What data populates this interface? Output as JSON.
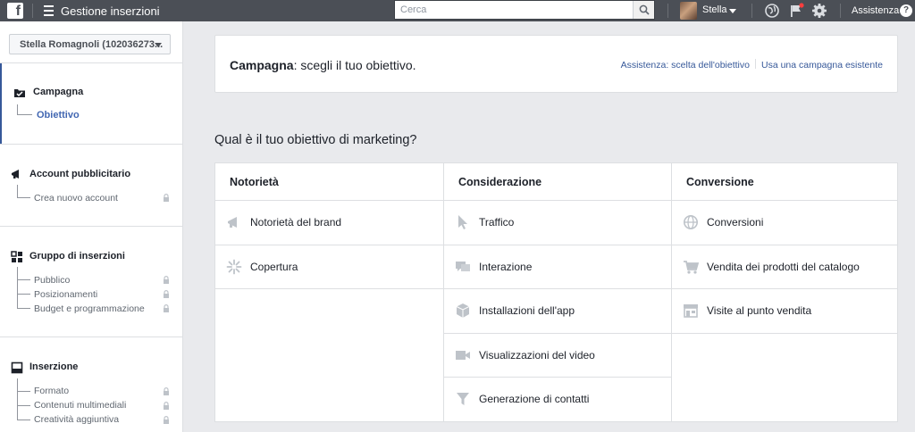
{
  "topbar": {
    "logo": "f",
    "title": "Gestione inserzioni",
    "search_placeholder": "Cerca",
    "user_name": "Stella",
    "help_label": "Assistenza",
    "icons": [
      "facebook-logo",
      "menu-icon",
      "search-icon",
      "globe-icon",
      "flag-icon",
      "gear-icon",
      "help-icon"
    ]
  },
  "sidebar": {
    "account_selector": "Stella Romagnoli (102036273...",
    "sections": [
      {
        "title": "Campagna",
        "icon": "campaign-folder-icon",
        "items": [
          {
            "label": "Obiettivo",
            "active": true,
            "locked": false
          }
        ]
      },
      {
        "title": "Account pubblicitario",
        "icon": "megaphone-icon",
        "items": [
          {
            "label": "Crea nuovo account",
            "locked": true
          }
        ]
      },
      {
        "title": "Gruppo di inserzioni",
        "icon": "grid-icon",
        "items": [
          {
            "label": "Pubblico",
            "locked": true
          },
          {
            "label": "Posizionamenti",
            "locked": true
          },
          {
            "label": "Budget e programmazione",
            "locked": true
          }
        ]
      },
      {
        "title": "Inserzione",
        "icon": "ad-icon",
        "items": [
          {
            "label": "Formato",
            "locked": true
          },
          {
            "label": "Contenuti multimediali",
            "locked": true
          },
          {
            "label": "Creatività aggiuntiva",
            "locked": true
          }
        ]
      }
    ]
  },
  "header": {
    "title_bold": "Campagna",
    "title_rest": ": scegli il tuo obiettivo.",
    "link_help": "Assistenza: scelta dell'obiettivo",
    "link_existing": "Usa una campagna esistente"
  },
  "question": "Qual è il tuo obiettivo di marketing?",
  "objectives": [
    {
      "heading": "Notorietà",
      "options": [
        {
          "label": "Notorietà del brand",
          "icon": "megaphone-icon"
        },
        {
          "label": "Copertura",
          "icon": "reach-icon"
        }
      ]
    },
    {
      "heading": "Considerazione",
      "options": [
        {
          "label": "Traffico",
          "icon": "cursor-icon"
        },
        {
          "label": "Interazione",
          "icon": "chat-bubbles-icon"
        },
        {
          "label": "Installazioni dell'app",
          "icon": "box-icon"
        },
        {
          "label": "Visualizzazioni del video",
          "icon": "video-camera-icon"
        },
        {
          "label": "Generazione di contatti",
          "icon": "funnel-icon"
        }
      ]
    },
    {
      "heading": "Conversione",
      "options": [
        {
          "label": "Conversioni",
          "icon": "globe-icon"
        },
        {
          "label": "Vendita dei prodotti del catalogo",
          "icon": "cart-icon"
        },
        {
          "label": "Visite al punto vendita",
          "icon": "store-icon"
        }
      ]
    }
  ],
  "colors": {
    "topbar": "#4b4f56",
    "link": "#365899",
    "active": "#4267b2",
    "icon_gray": "#bec3c9"
  }
}
